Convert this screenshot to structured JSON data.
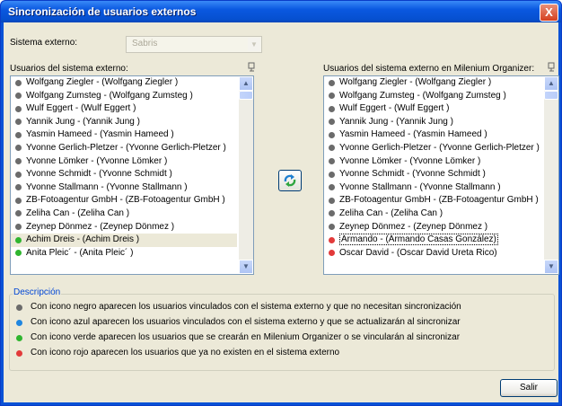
{
  "window": {
    "title": "Sincronización de usuarios externos",
    "close_label": "X"
  },
  "external_system": {
    "label": "Sistema externo:",
    "value": "Sabris"
  },
  "left_list": {
    "label": "Usuarios del sistema externo:",
    "items": [
      {
        "text": "Wolfgang Ziegler - (Wolfgang Ziegler )",
        "color": "#6b6b6b"
      },
      {
        "text": "Wolfgang Zumsteg - (Wolfgang Zumsteg )",
        "color": "#6b6b6b"
      },
      {
        "text": "Wulf Eggert - (Wulf Eggert )",
        "color": "#6b6b6b"
      },
      {
        "text": "Yannik Jung - (Yannik Jung )",
        "color": "#6b6b6b"
      },
      {
        "text": "Yasmin Hameed - (Yasmin Hameed )",
        "color": "#6b6b6b"
      },
      {
        "text": "Yvonne Gerlich-Pletzer - (Yvonne Gerlich-Pletzer )",
        "color": "#6b6b6b"
      },
      {
        "text": "Yvonne Lömker - (Yvonne Lömker )",
        "color": "#6b6b6b"
      },
      {
        "text": "Yvonne Schmidt - (Yvonne Schmidt )",
        "color": "#6b6b6b"
      },
      {
        "text": "Yvonne Stallmann - (Yvonne Stallmann )",
        "color": "#6b6b6b"
      },
      {
        "text": "ZB-Fotoagentur GmbH - (ZB-Fotoagentur GmbH )",
        "color": "#6b6b6b"
      },
      {
        "text": "Zeliha Can - (Zeliha Can )",
        "color": "#6b6b6b"
      },
      {
        "text": "Zeynep Dönmez - (Zeynep Dönmez )",
        "color": "#6b6b6b"
      },
      {
        "text": "Achim Dreis - (Achim Dreis )",
        "color": "#2fb52f",
        "selected": true
      },
      {
        "text": "Anita Pleic´ - (Anita Pleic´ )",
        "color": "#2fb52f"
      }
    ]
  },
  "right_list": {
    "label": "Usuarios del sistema externo en Milenium Organizer:",
    "items": [
      {
        "text": "Wolfgang Ziegler - (Wolfgang Ziegler )",
        "color": "#6b6b6b"
      },
      {
        "text": "Wolfgang Zumsteg - (Wolfgang Zumsteg )",
        "color": "#6b6b6b"
      },
      {
        "text": "Wulf Eggert - (Wulf Eggert )",
        "color": "#6b6b6b"
      },
      {
        "text": "Yannik Jung - (Yannik Jung )",
        "color": "#6b6b6b"
      },
      {
        "text": "Yasmin Hameed - (Yasmin Hameed )",
        "color": "#6b6b6b"
      },
      {
        "text": "Yvonne Gerlich-Pletzer - (Yvonne Gerlich-Pletzer )",
        "color": "#6b6b6b"
      },
      {
        "text": "Yvonne Lömker - (Yvonne Lömker )",
        "color": "#6b6b6b"
      },
      {
        "text": "Yvonne Schmidt - (Yvonne Schmidt )",
        "color": "#6b6b6b"
      },
      {
        "text": "Yvonne Stallmann - (Yvonne Stallmann )",
        "color": "#6b6b6b"
      },
      {
        "text": "ZB-Fotoagentur GmbH - (ZB-Fotoagentur GmbH )",
        "color": "#6b6b6b"
      },
      {
        "text": "Zeliha Can - (Zeliha Can )",
        "color": "#6b6b6b"
      },
      {
        "text": "Zeynep Dönmez - (Zeynep Dönmez )",
        "color": "#6b6b6b"
      },
      {
        "text": "Armando - (Armando Casas González)",
        "color": "#e23a3a",
        "focused": true
      },
      {
        "text": "Oscar David - (Oscar David Ureta Rico)",
        "color": "#e23a3a"
      }
    ]
  },
  "sync_button": {
    "icon": "sync-arrows-icon"
  },
  "legend": {
    "title": "Descripción",
    "rows": [
      {
        "text": "Con icono negro aparecen los usuarios vinculados con el sistema externo y que no necesitan sincronización",
        "color": "#6b6b6b"
      },
      {
        "text": "Con icono azul aparecen los usuarios vinculados con el sistema externo y que se actualizarán al sincronizar",
        "color": "#1f86e0"
      },
      {
        "text": "Con icono verde aparecen los usuarios que se crearán en Milenium Organizer o se vincularán al sincronizar",
        "color": "#2fb52f"
      },
      {
        "text": "Con icono rojo aparecen los usuarios que ya no existen en el sistema externo",
        "color": "#e23a3a"
      }
    ]
  },
  "exit_button": {
    "label": "Salir"
  }
}
